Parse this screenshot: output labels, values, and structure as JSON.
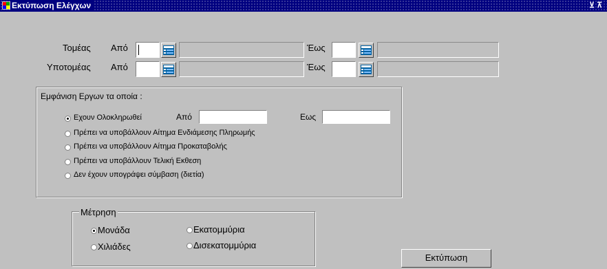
{
  "window": {
    "title": "Εκτύπωση Ελέγχων",
    "controls_label": "⊻ ⊼"
  },
  "filters": {
    "tomeas_label": "Τομέας",
    "ypotomeas_label": "Υποτομέας",
    "apo_label": "Από",
    "eos_label": "Έως"
  },
  "erga_group": {
    "title": "Εμφάνιση Εργων τα οποία :",
    "options": [
      "Εχουν Ολοκληρωθεί",
      "Πρέπει να υποβάλλουν Αίτημα Ενδιάμεσης Πληρωμής",
      "Πρέπει να υποβάλλουν Αίτημα Προκαταβολής",
      "Πρέπει να υποβάλλουν Τελική Εκθεση",
      "Δεν έχουν υπογράψει σύμβαση (διετία)"
    ],
    "selected_index": 0,
    "apo_label": "Από",
    "eos_label": "Εως"
  },
  "metrisi_group": {
    "title": "Μέτρηση",
    "options": [
      "Μονάδα",
      "Εκατομμύρια",
      "Χιλιάδες",
      "Δισεκατομμύρια"
    ],
    "selected_index": 0
  },
  "print_button_label": "Εκτύπωση"
}
